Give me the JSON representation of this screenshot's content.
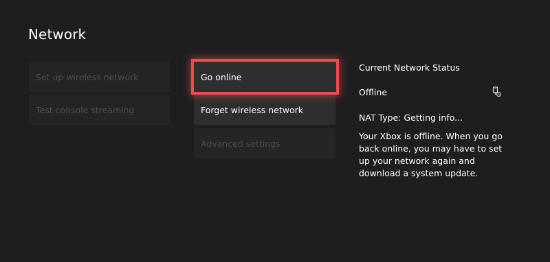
{
  "page": {
    "title": "Network"
  },
  "left_menu": {
    "items": [
      {
        "label": "Set up wireless network"
      },
      {
        "label": "Test console streaming"
      }
    ]
  },
  "actions": {
    "items": [
      {
        "label": "Go online",
        "focused": true
      },
      {
        "label": "Forget wireless network"
      },
      {
        "label": "Advanced settings",
        "disabled": true
      }
    ]
  },
  "status": {
    "title": "Current Network Status",
    "value": "Offline",
    "icon": "network-status-icon",
    "nat": "NAT Type: Getting info...",
    "description": "Your Xbox is offline. When you go back online, you may have to set up your network again and download a system update."
  },
  "colors": {
    "background": "#1e1e1e",
    "focus_border": "#ec4e50",
    "tile": "#2e2e2e",
    "disabled_text": "#4f4f4f"
  }
}
